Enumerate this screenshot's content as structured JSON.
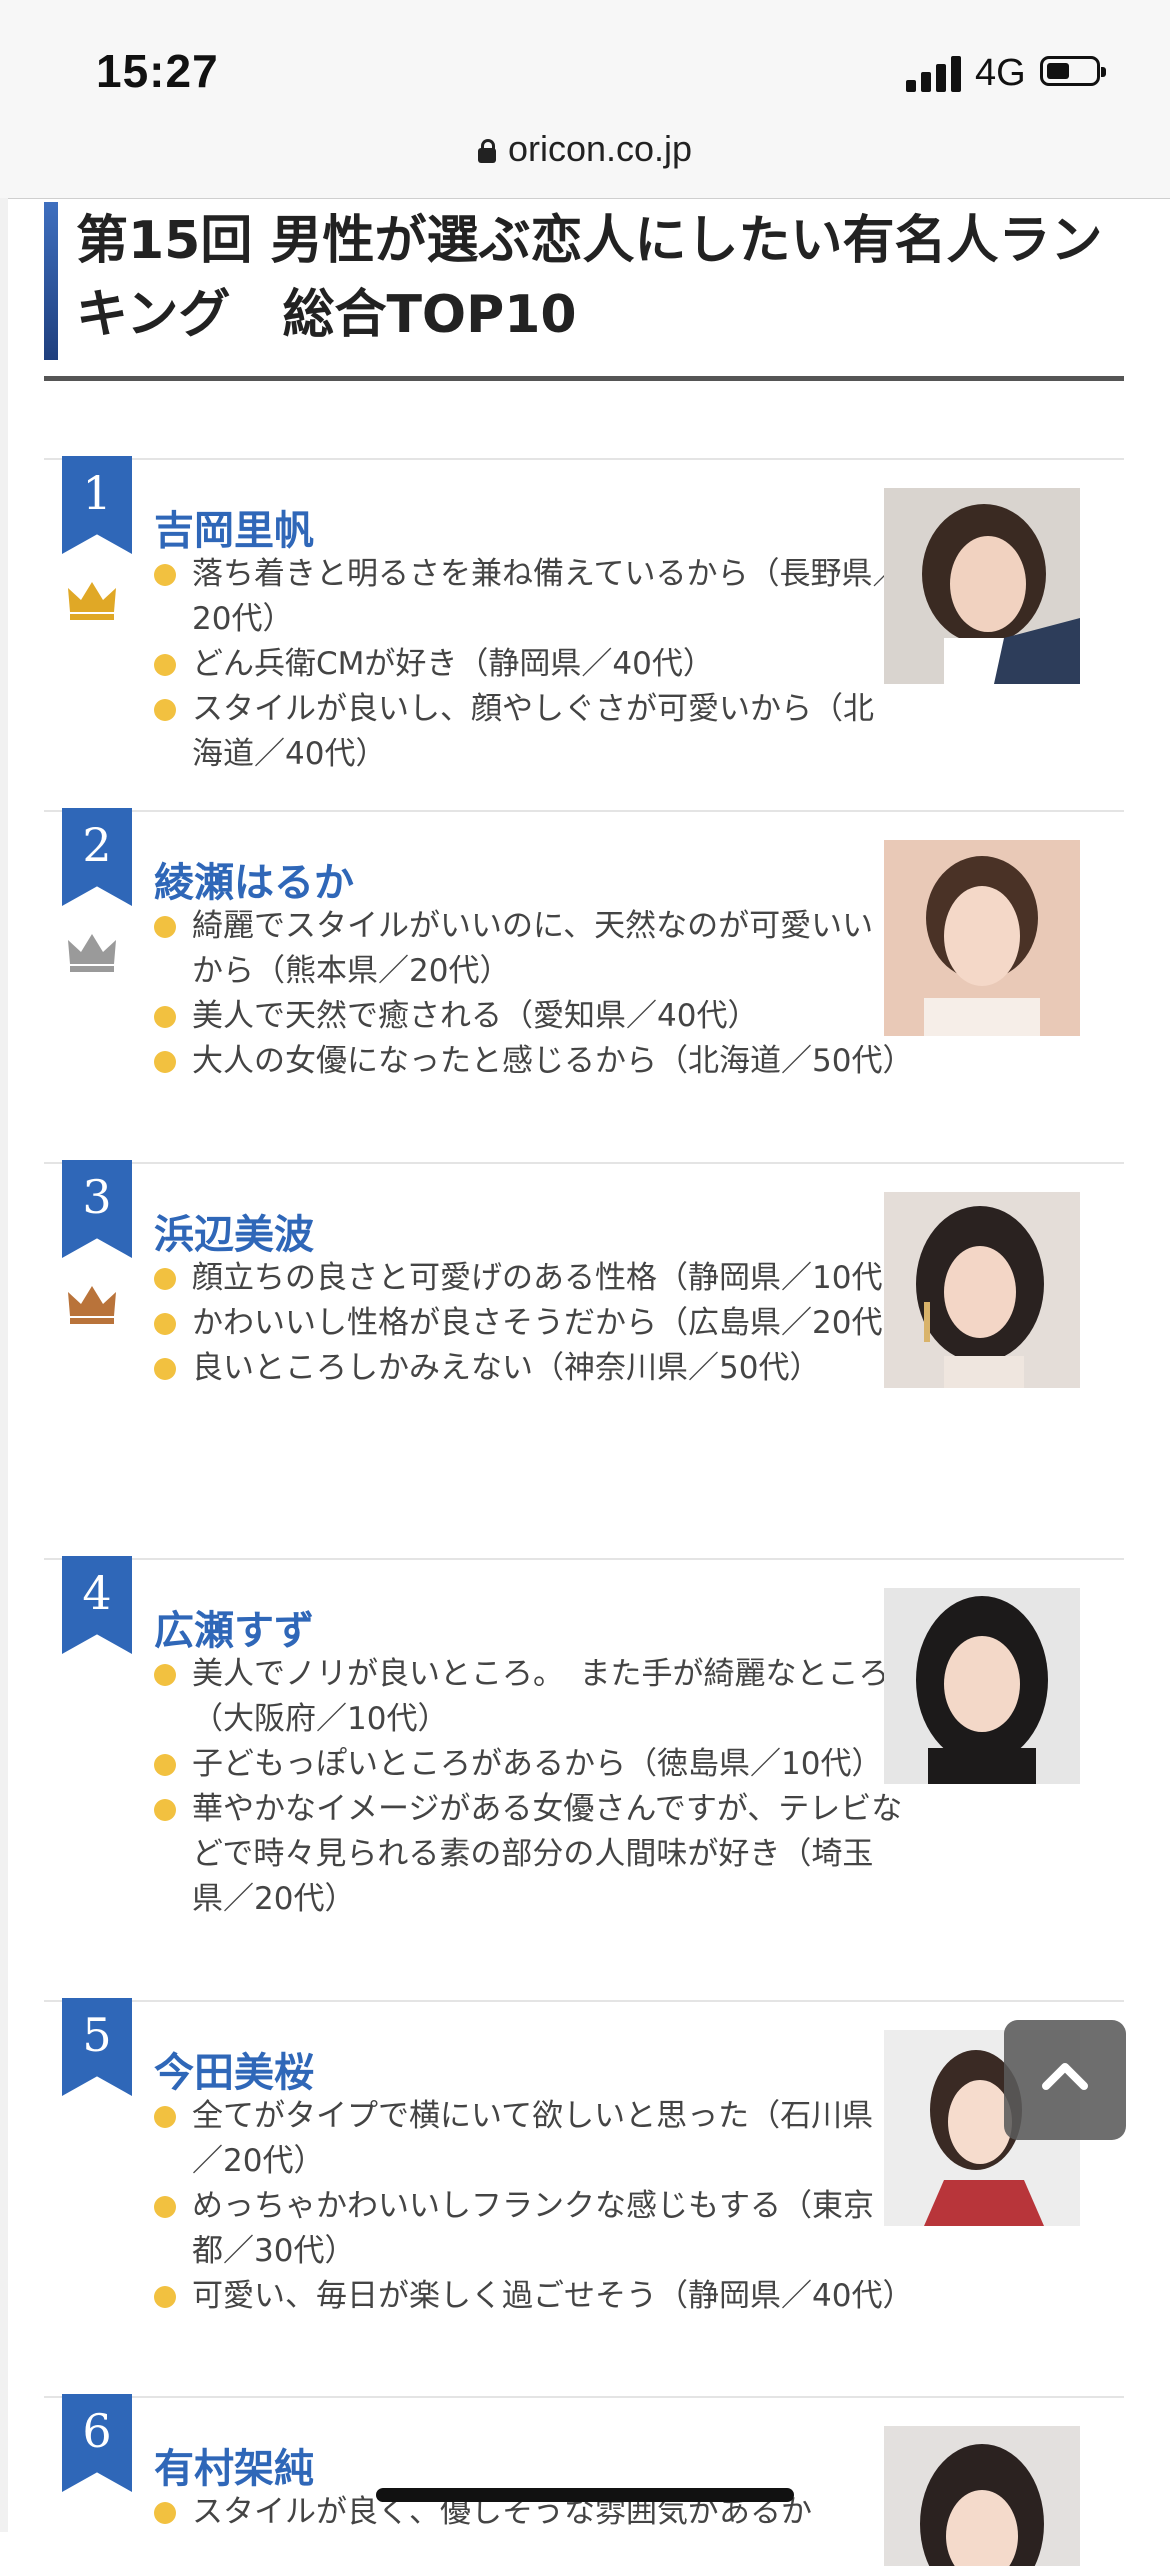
{
  "status_bar": {
    "time": "15:27",
    "network": "4G"
  },
  "browser": {
    "url": "oricon.co.jp"
  },
  "heading": {
    "title": "第15回 男性が選ぶ恋人にしたい有名人ラン\nキング　総合TOP10"
  },
  "ranking": [
    {
      "rank": "1",
      "name": "吉岡里帆",
      "crown": "gold-crown-icon",
      "comments": [
        "落ち着きと明るさを兼ね備えているから（長野県／20代）",
        "どん兵衛CMが好き（静岡県／40代）",
        "スタイルが良いし、顔やしぐさが可愛いから（北海道／40代）"
      ]
    },
    {
      "rank": "2",
      "name": "綾瀬はるか",
      "crown": "silver-crown-icon",
      "comments": [
        "綺麗でスタイルがいいのに、天然なのが可愛いいから（熊本県／20代）",
        "美人で天然で癒される（愛知県／40代）",
        "大人の女優になったと感じるから（北海道／50代）"
      ]
    },
    {
      "rank": "3",
      "name": "浜辺美波",
      "crown": "bronze-crown-icon",
      "comments": [
        "顔立ちの良さと可愛げのある性格（静岡県／10代）",
        "かわいいし性格が良さそうだから（広島県／20代）",
        "良いところしかみえない（神奈川県／50代）"
      ]
    },
    {
      "rank": "4",
      "name": "広瀬すず",
      "crown": "",
      "comments": [
        "美人でノリが良いところ。　また手が綺麗なところ（大阪府／10代）",
        "子どもっぽいところがあるから（徳島県／10代）",
        "華やかなイメージがある女優さんですが、テレビなどで時々見られる素の部分の人間味が好き（埼玉県／20代）"
      ]
    },
    {
      "rank": "5",
      "name": "今田美桜",
      "crown": "",
      "comments": [
        "全てがタイプで横にいて欲しいと思った（石川県／20代）",
        "めっちゃかわいいしフランクな感じもする（東京都／30代）",
        "可愛い、毎日が楽しく過ごせそう（静岡県／40代）"
      ]
    },
    {
      "rank": "6",
      "name": "有村架純",
      "crown": "",
      "comments": [
        "スタイルが良く、優しそうな雰囲気があるか"
      ]
    }
  ],
  "colors": {
    "accent": "#2f67b8",
    "bullet": "#f2c140",
    "gold": "#e0a826",
    "silver": "#9a9a9a",
    "bronze": "#b9733a"
  }
}
